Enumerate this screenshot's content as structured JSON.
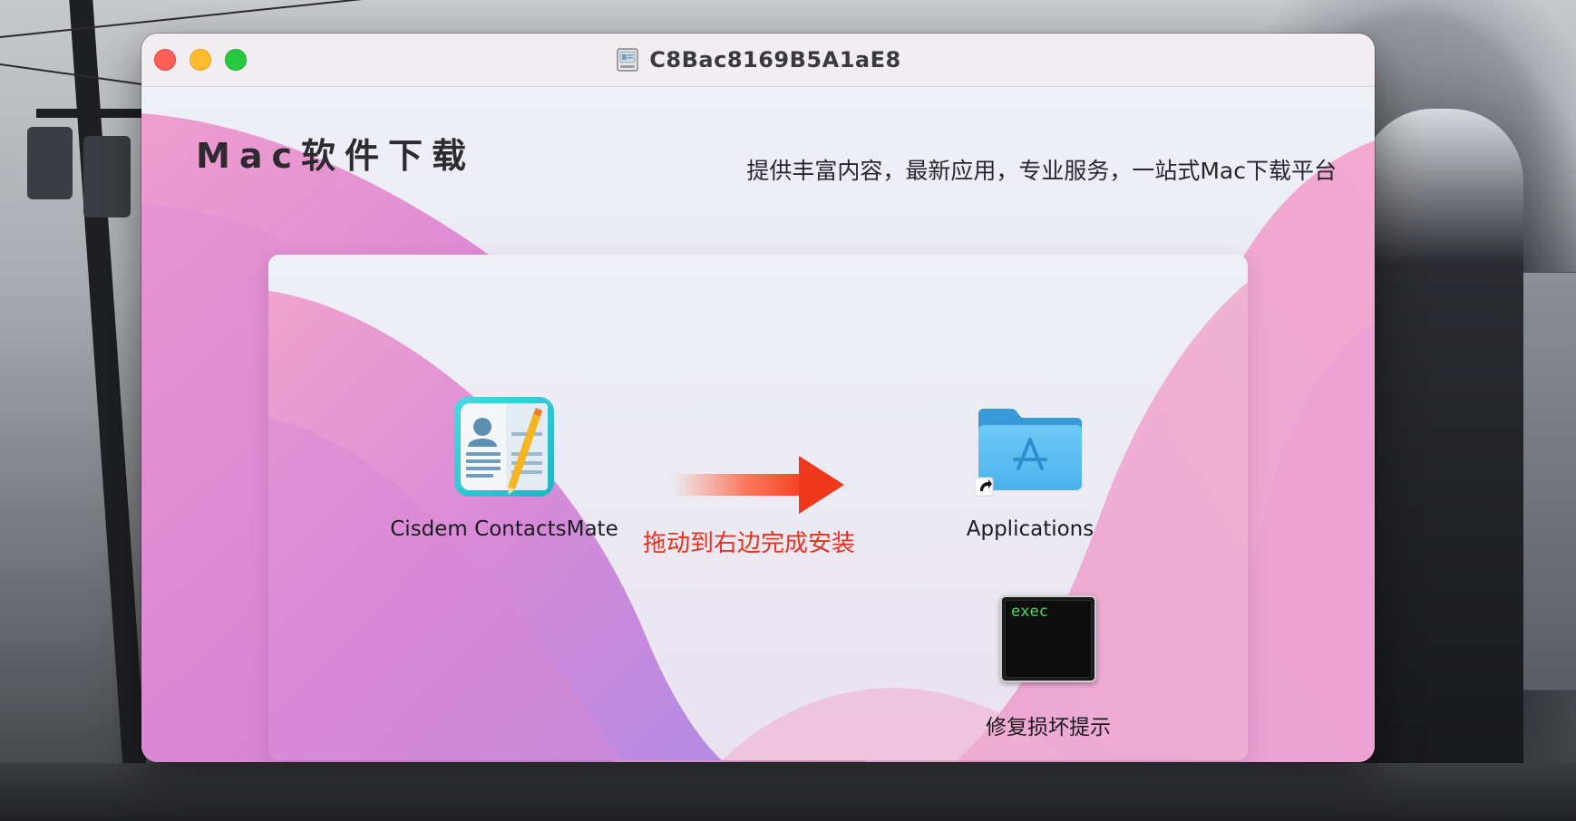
{
  "window": {
    "title": "C8Bac8169B5A1aE8"
  },
  "header": {
    "brand_title": "Mac软件下载",
    "slogan": "提供丰富内容，最新应用，专业服务，一站式Mac下载平台"
  },
  "installer": {
    "app_label": "Cisdem ContactsMate",
    "install_hint": "拖动到右边完成安装",
    "applications_label": "Applications",
    "exec_icon_text": "exec",
    "repair_label": "修复损坏提示"
  },
  "colors": {
    "hint_red": "#e6321f",
    "close": "#fe5f57",
    "minimize": "#febc2e",
    "zoom": "#28c840",
    "folder_blue": "#5ec1f5",
    "app_teal": "#2ec8d6"
  },
  "icons": {
    "disk": "disk-image-icon",
    "app": "contacts-app-icon",
    "arrow": "right-arrow-icon",
    "folder": "applications-folder-icon",
    "alias": "alias-arrow-icon",
    "exec": "terminal-exec-icon"
  }
}
